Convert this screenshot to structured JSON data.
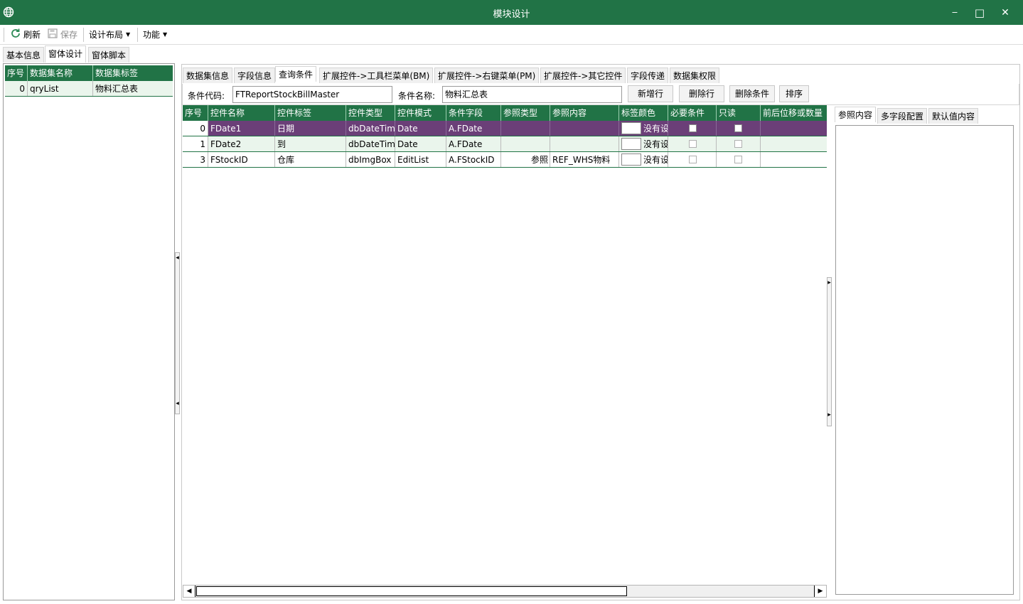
{
  "window": {
    "title": "模块设计",
    "minimize_glyph": "‒",
    "maximize_glyph": "□",
    "close_glyph": "✕"
  },
  "toolbar": {
    "refresh_label": "刷新",
    "save_label": "保存",
    "design_layout_label": "设计布局",
    "function_label": "功能"
  },
  "top_tabs": [
    "基本信息",
    "窗体设计",
    "窗体脚本"
  ],
  "top_tabs_active": 1,
  "dataset_grid": {
    "columns": [
      "序号",
      "数据集名称",
      "数据集标签"
    ],
    "rows": [
      {
        "index": "0",
        "name": "qryList",
        "label": "物料汇总表"
      }
    ]
  },
  "sub_tabs": [
    "数据集信息",
    "字段信息",
    "查询条件",
    "扩展控件->工具栏菜单(BM)",
    "扩展控件->右键菜单(PM)",
    "扩展控件->其它控件",
    "字段传递",
    "数据集权限"
  ],
  "sub_tabs_active": 2,
  "condition": {
    "code_label": "条件代码:",
    "code_value": "FTReportStockBillMaster",
    "name_label": "条件名称:",
    "name_value": "物料汇总表",
    "btn_add_row": "新增行",
    "btn_delete_row": "删除行",
    "btn_delete_condition": "删除条件",
    "btn_sort": "排序"
  },
  "query_grid": {
    "columns": [
      "序号",
      "控件名称",
      "控件标签",
      "控件类型",
      "控件模式",
      "条件字段",
      "参照类型",
      "参照内容",
      "标签颜色",
      "必要条件",
      "只读",
      "前后位移或数量"
    ],
    "rows": [
      {
        "index": "0",
        "name": "FDate1",
        "label": "日期",
        "type": "dbDateTim",
        "mode": "Date",
        "field": "A.FDate",
        "ref_type": "",
        "ref_content": "",
        "color_text": "没有设",
        "required": false,
        "readonly": false,
        "offset": ""
      },
      {
        "index": "1",
        "name": "FDate2",
        "label": "到",
        "type": "dbDateTim",
        "mode": "Date",
        "field": "A.FDate",
        "ref_type": "",
        "ref_content": "",
        "color_text": "没有设",
        "required": false,
        "readonly": false,
        "offset": ""
      },
      {
        "index": "3",
        "name": "FStockID",
        "label": "仓库",
        "type": "dbImgBox",
        "mode": "EditList",
        "field": "A.FStockID",
        "ref_type": "参照",
        "ref_content": "REF_WHS物料",
        "color_text": "没有设",
        "required": false,
        "readonly": false,
        "offset": ""
      }
    ],
    "selected_row": 0
  },
  "right_tabs": [
    "参照内容",
    "多字段配置",
    "默认值内容"
  ],
  "right_tabs_active": 0,
  "colors": {
    "accent": "#217346",
    "selected_row": "#6b3f78",
    "alt_row": "#eaf5ec"
  }
}
